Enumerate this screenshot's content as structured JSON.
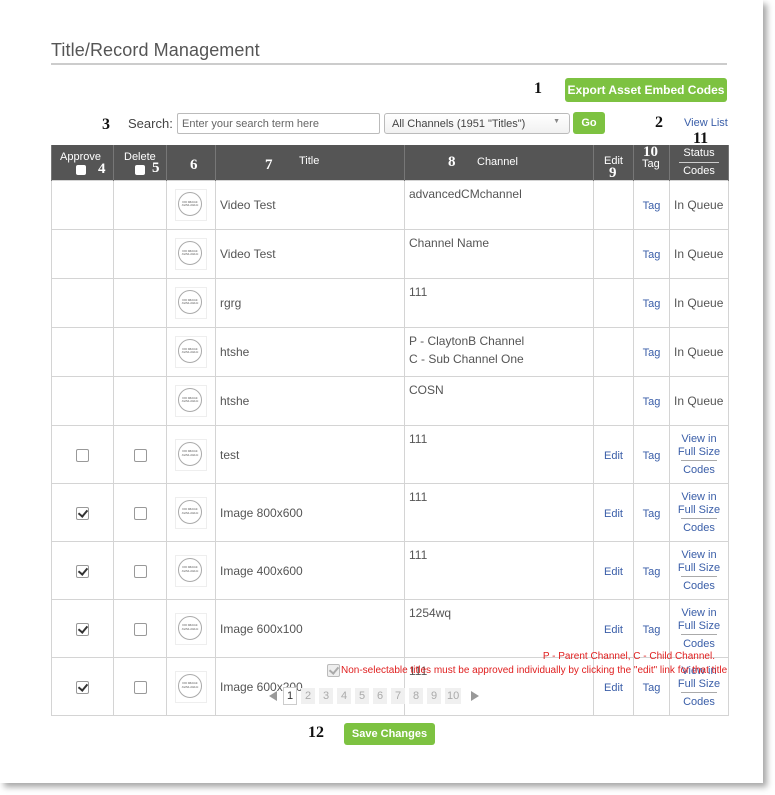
{
  "page": {
    "title": "Title/Record Management"
  },
  "markers": {
    "m1": "1",
    "m2": "2",
    "m3": "3",
    "m4": "4",
    "m5": "5",
    "m6": "6",
    "m7": "7",
    "m8": "8",
    "m9": "9",
    "m10": "10",
    "m11": "11",
    "m12": "12"
  },
  "toolbar": {
    "export_label": "Export Asset Embed Codes",
    "search_label": "Search:",
    "search_placeholder": "Enter your search term here",
    "search_value": "",
    "channel_select_value": "All Channels (1951 \"Titles\")",
    "go_label": "Go",
    "view_list_label": "View List"
  },
  "colors": {
    "accent_green": "#7dc241",
    "header_bg": "#555555",
    "link_blue": "#3a5ea8",
    "notice_red": "#e02020"
  },
  "table": {
    "headers": {
      "approve": "Approve",
      "delete": "Delete",
      "title": "Title",
      "channel": "Channel",
      "edit": "Edit",
      "tag": "Tag",
      "status": "Status",
      "codes": "Codes"
    },
    "thumbnail_text": "NO IMAGE AVAILABLE",
    "rows": [
      {
        "title": "Video Test",
        "channels": [
          "advancedCMchannel"
        ],
        "selectable": false,
        "tag": "Tag",
        "status": "In Queue"
      },
      {
        "title": "Video Test",
        "channels": [
          "Channel Name"
        ],
        "selectable": false,
        "tag": "Tag",
        "status": "In Queue"
      },
      {
        "title": "rgrg",
        "channels": [
          "111"
        ],
        "selectable": false,
        "tag": "Tag",
        "status": "In Queue"
      },
      {
        "title": "htshe",
        "channels": [
          "P - ClaytonB Channel",
          "C - Sub Channel One"
        ],
        "selectable": false,
        "tag": "Tag",
        "status": "In Queue"
      },
      {
        "title": "htshe",
        "channels": [
          "COSN"
        ],
        "selectable": false,
        "tag": "Tag",
        "status": "In Queue"
      },
      {
        "title": "test",
        "channels": [
          "111"
        ],
        "selectable": true,
        "approve": false,
        "delete": false,
        "edit": "Edit",
        "tag": "Tag",
        "view": "View in Full Size",
        "codes": "Codes"
      },
      {
        "title": "Image 800x600",
        "channels": [
          "111"
        ],
        "selectable": true,
        "approve": true,
        "delete": false,
        "edit": "Edit",
        "tag": "Tag",
        "view": "View in Full Size",
        "codes": "Codes"
      },
      {
        "title": "Image 400x600",
        "channels": [
          "111"
        ],
        "selectable": true,
        "approve": true,
        "delete": false,
        "edit": "Edit",
        "tag": "Tag",
        "view": "View in Full Size",
        "codes": "Codes"
      },
      {
        "title": "Image 600x100",
        "channels": [
          "1254wq"
        ],
        "selectable": true,
        "approve": true,
        "delete": false,
        "edit": "Edit",
        "tag": "Tag",
        "view": "View in Full Size",
        "codes": "Codes"
      },
      {
        "title": "Image 600x200",
        "channels": [
          "111"
        ],
        "selectable": true,
        "approve": true,
        "delete": false,
        "edit": "Edit",
        "tag": "Tag",
        "view": "View in Full Size",
        "codes": "Codes"
      }
    ]
  },
  "legend": {
    "channel_key": "P - Parent Channel, C - Child Channel.",
    "notice": "Non-selectable titles must be approved individually by clicking the \"edit\" link for that title"
  },
  "pagination": {
    "current": 1,
    "pages": [
      "1",
      "2",
      "3",
      "4",
      "5",
      "6",
      "7",
      "8",
      "9",
      "10"
    ]
  },
  "footer": {
    "save_label": "Save Changes"
  }
}
